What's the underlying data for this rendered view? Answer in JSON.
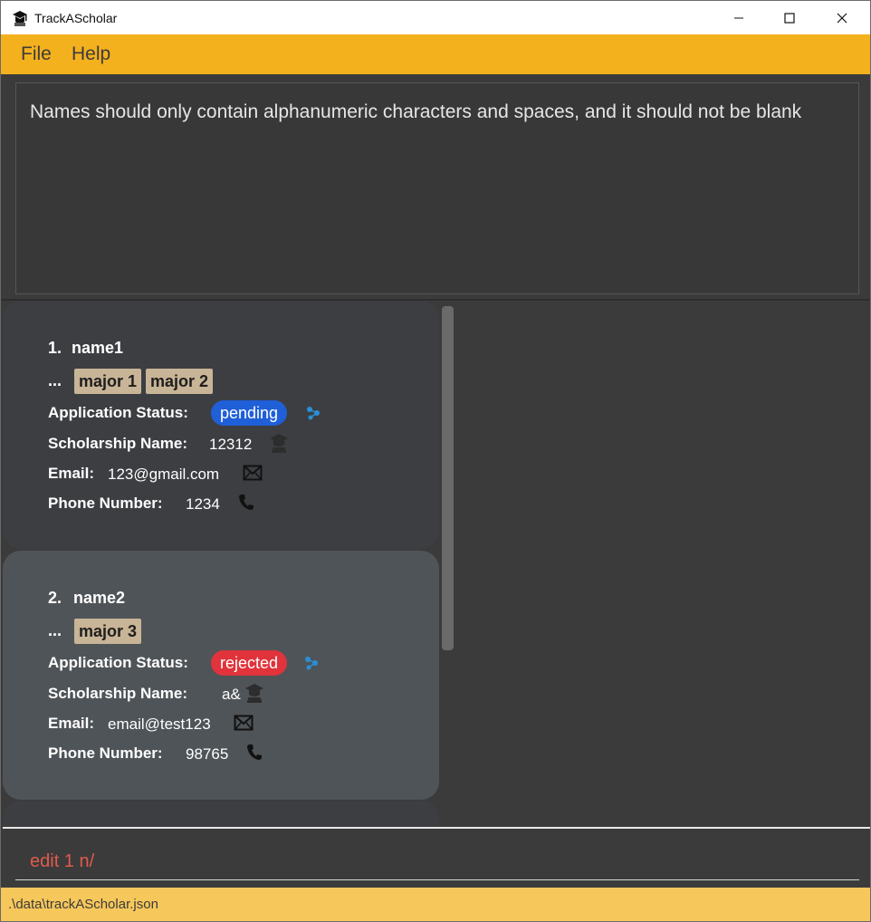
{
  "window": {
    "title": "TrackAScholar",
    "icon": "graduation-cap-icon",
    "controls": [
      "minimize-icon",
      "maximize-icon",
      "close-icon"
    ]
  },
  "menu": {
    "file": "File",
    "help": "Help"
  },
  "result": {
    "message": "Names should only contain alphanumeric characters and spaces, and it should not be blank"
  },
  "applicants": [
    {
      "index": "1.",
      "name": "name1",
      "dots": "...",
      "majors": [
        "major 1",
        "major 2"
      ],
      "status_label": "Application Status:",
      "status": "pending",
      "status_color": "#1f5fd8",
      "scholarship_label": "Scholarship Name:",
      "scholarship": "12312",
      "email_label": "Email:",
      "email": "123@gmail.com",
      "phone_label": "Phone Number:",
      "phone": "1234"
    },
    {
      "index": "2.",
      "name": "name2",
      "dots": "...",
      "majors": [
        "major 3"
      ],
      "status_label": "Application Status:",
      "status": "rejected",
      "status_color": "#e0333b",
      "scholarship_label": "Scholarship Name:",
      "scholarship": "a&",
      "email_label": "Email:",
      "email": "email@test123",
      "phone_label": "Phone Number:",
      "phone": "98765"
    }
  ],
  "command": {
    "value": "edit 1 n/"
  },
  "status_bar": {
    "path": ".\\data\\trackAScholar.json"
  },
  "colors": {
    "menu_bar": "#f4b11e",
    "status_bar": "#f6c75b",
    "background": "#3b3b3b",
    "command_text_error": "#e05a4c",
    "tag": "#c8b496"
  }
}
